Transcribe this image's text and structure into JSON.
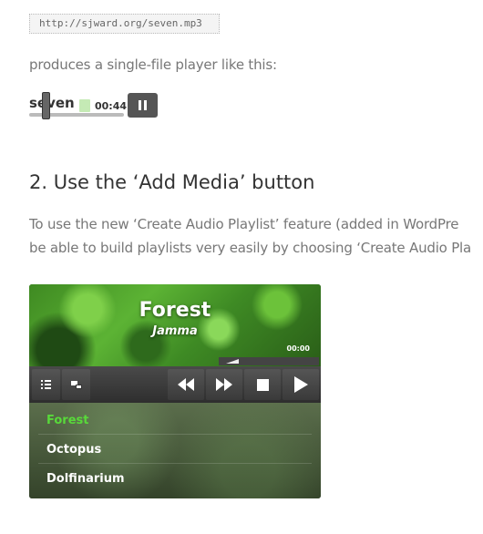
{
  "code_url": "http://sjward.org/seven.mp3",
  "intro_text": "produces a single-file player like this:",
  "mini_player": {
    "title": "seven",
    "time": "00:44",
    "pause_icon": "pause-icon"
  },
  "section_heading": "2. Use the ‘Add Media’ button",
  "body_line1": "To use the new ‘Create Audio Playlist’ feature (added in WordPre",
  "body_line2": "be able to build playlists very easily by choosing ‘Create Audio Pla",
  "playlist_player": {
    "track_title": "Forest",
    "artist": "Jamma",
    "time": "00:00",
    "controls": [
      "list-icon",
      "minimize-icon",
      "rewind-icon",
      "fast-forward-icon",
      "stop-icon",
      "play-icon"
    ],
    "tracks": [
      "Forest",
      "Octopus",
      "Dolfinarium"
    ],
    "active_track_color": "#58d93a"
  }
}
